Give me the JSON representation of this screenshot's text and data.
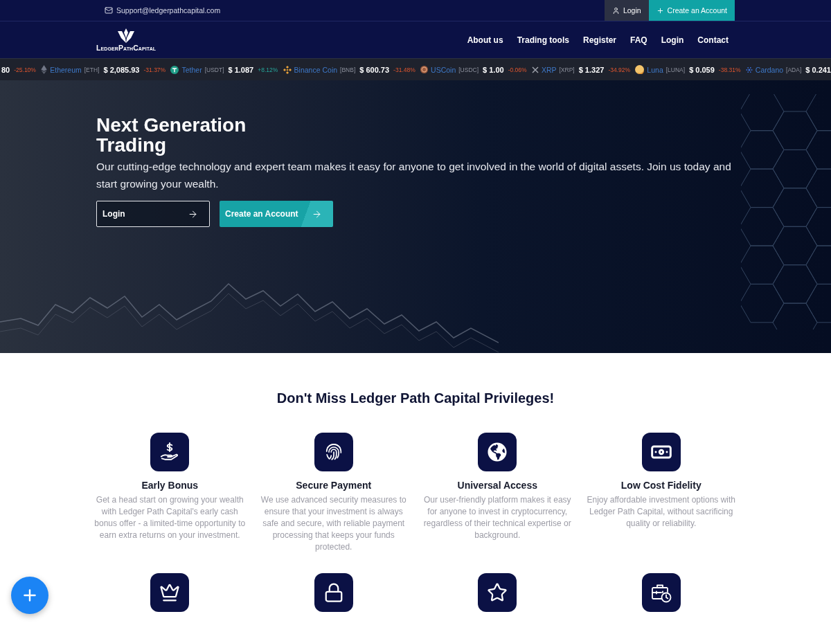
{
  "top_bar": {
    "email": "Support@ledgerpathcapital.com",
    "buttons": [
      {
        "kind": "login",
        "label": "Login"
      },
      {
        "kind": "signup",
        "label": "Create an Account"
      }
    ]
  },
  "header": {
    "logo_text": "LedgerPathCapital",
    "nav": [
      "About us",
      "Trading tools",
      "Register",
      "FAQ",
      "Login",
      "Contact"
    ]
  },
  "ticker": [
    {
      "price": "80",
      "change": "-25.10%",
      "rising": false
    },
    {
      "name": "Ethereum",
      "symbol": "[ETH]",
      "price": "$ 2,085.93",
      "change": "-31.37%",
      "rising": false
    },
    {
      "name": "Tether",
      "symbol": "[USDT]",
      "price": "$ 1.087",
      "change": "+8.12%",
      "rising": true
    },
    {
      "name": "Binance Coin",
      "symbol": "[BNB]",
      "price": "$ 600.73",
      "change": "-31.48%",
      "rising": false
    },
    {
      "name": "USCoin",
      "symbol": "[USDC]",
      "price": "$ 1.00",
      "change": "-0.06%",
      "rising": false
    },
    {
      "name": "XRP",
      "symbol": "[XRP]",
      "price": "$ 1.327",
      "change": "-34.92%",
      "rising": false
    },
    {
      "name": "Luna",
      "symbol": "[LUNA]",
      "price": "$ 0.059",
      "change": "-38.31%",
      "rising": false
    },
    {
      "name": "Cardano",
      "symbol": "[ADA]",
      "price": "$ 0.241"
    }
  ],
  "hero": {
    "title": "Next Generation Trading",
    "text": "Our cutting-edge technology and expert team makes it easy for anyone to get involved in the world of digital assets. Join us today and start growing your wealth.",
    "buttons": [
      {
        "kind": "outline",
        "label": "Login"
      },
      {
        "kind": "filled",
        "label": "Create an Account"
      }
    ]
  },
  "privileges": {
    "title": "Don't Miss Ledger Path Capital Privileges!",
    "features": [
      {
        "kind": "full",
        "title": "Early Bonus",
        "description": "Get a head start on growing your wealth with Ledger Path Capital's early cash bonus offer - a limited-time opportunity to earn extra returns on your investment."
      },
      {
        "kind": "full",
        "title": "Secure Payment",
        "description": "We use advanced security measures to ensure that your investment is always safe and secure, with reliable payment processing that keeps your funds protected."
      },
      {
        "kind": "full",
        "title": "Universal Access",
        "description": "Our user-friendly platform makes it easy for anyone to invest in cryptocurrency, regardless of their technical expertise or background."
      },
      {
        "kind": "full",
        "title": "Low Cost Fidelity",
        "description": "Enjoy affordable investment options with Ledger Path Capital, without sacrificing quality or reliability."
      },
      {
        "kind": "icon_only"
      },
      {
        "kind": "icon_only"
      },
      {
        "kind": "icon_only"
      },
      {
        "kind": "icon_only"
      }
    ]
  }
}
